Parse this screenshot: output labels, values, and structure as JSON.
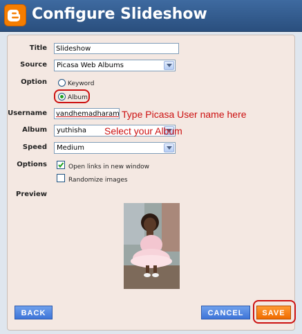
{
  "window": {
    "title": "Configure Slideshow",
    "logo_icon": "blogger-icon"
  },
  "form": {
    "title_label": "Title",
    "title_value": "Slideshow",
    "source_label": "Source",
    "source_value": "Picasa Web Albums",
    "option_label": "Option",
    "option_keyword": "Keyword",
    "option_album": "Album",
    "option_selected": "Album",
    "username_label": "Username",
    "username_value": "vandhemadharam",
    "album_label": "Album",
    "album_value": "yuthisha",
    "speed_label": "Speed",
    "speed_value": "Medium",
    "options_label": "Options",
    "open_links_label": "Open links in new window",
    "open_links_checked": true,
    "randomize_label": "Randomize images",
    "randomize_checked": false,
    "preview_label": "Preview"
  },
  "annotations": {
    "username_note": "Type Picasa User name here",
    "album_note": "Select your Album",
    "color": "#cc1111"
  },
  "buttons": {
    "back": "BACK",
    "cancel": "CANCEL",
    "save": "SAVE"
  },
  "colors": {
    "titlebar": "#2f5a8f",
    "panel": "#f4e8e2",
    "button_blue": "#4a80e0",
    "button_orange": "#f57d00"
  }
}
